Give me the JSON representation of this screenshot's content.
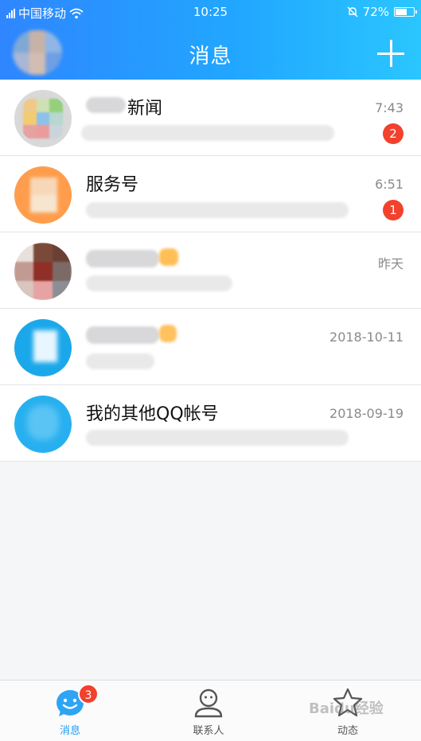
{
  "status_bar": {
    "carrier": "中国移动",
    "time": "10:25",
    "battery": "72%",
    "battery_level": 0.72
  },
  "header": {
    "title": "消息",
    "add_icon": "plus-icon"
  },
  "conversations": [
    {
      "title": "新闻",
      "time": "7:43",
      "badge": "2"
    },
    {
      "title": "服务号",
      "time": "6:51",
      "badge": "1"
    },
    {
      "title": "",
      "time": "昨天",
      "badge": ""
    },
    {
      "title": "",
      "time": "2018-10-11",
      "badge": ""
    },
    {
      "title": "我的其他QQ帐号",
      "time": "2018-09-19",
      "badge": ""
    }
  ],
  "tabbar": {
    "messages": {
      "label": "消息",
      "badge": "3",
      "icon": "chat-bubble-icon"
    },
    "contacts": {
      "label": "联系人",
      "icon": "person-icon"
    },
    "dynamic": {
      "label": "动态",
      "icon": "star-icon"
    }
  },
  "watermark": "Baidu经验",
  "colors": {
    "header_start": "#2f86ff",
    "header_end": "#2ac6ff",
    "badge": "#f2412c",
    "active_tab": "#1e9bf3"
  }
}
